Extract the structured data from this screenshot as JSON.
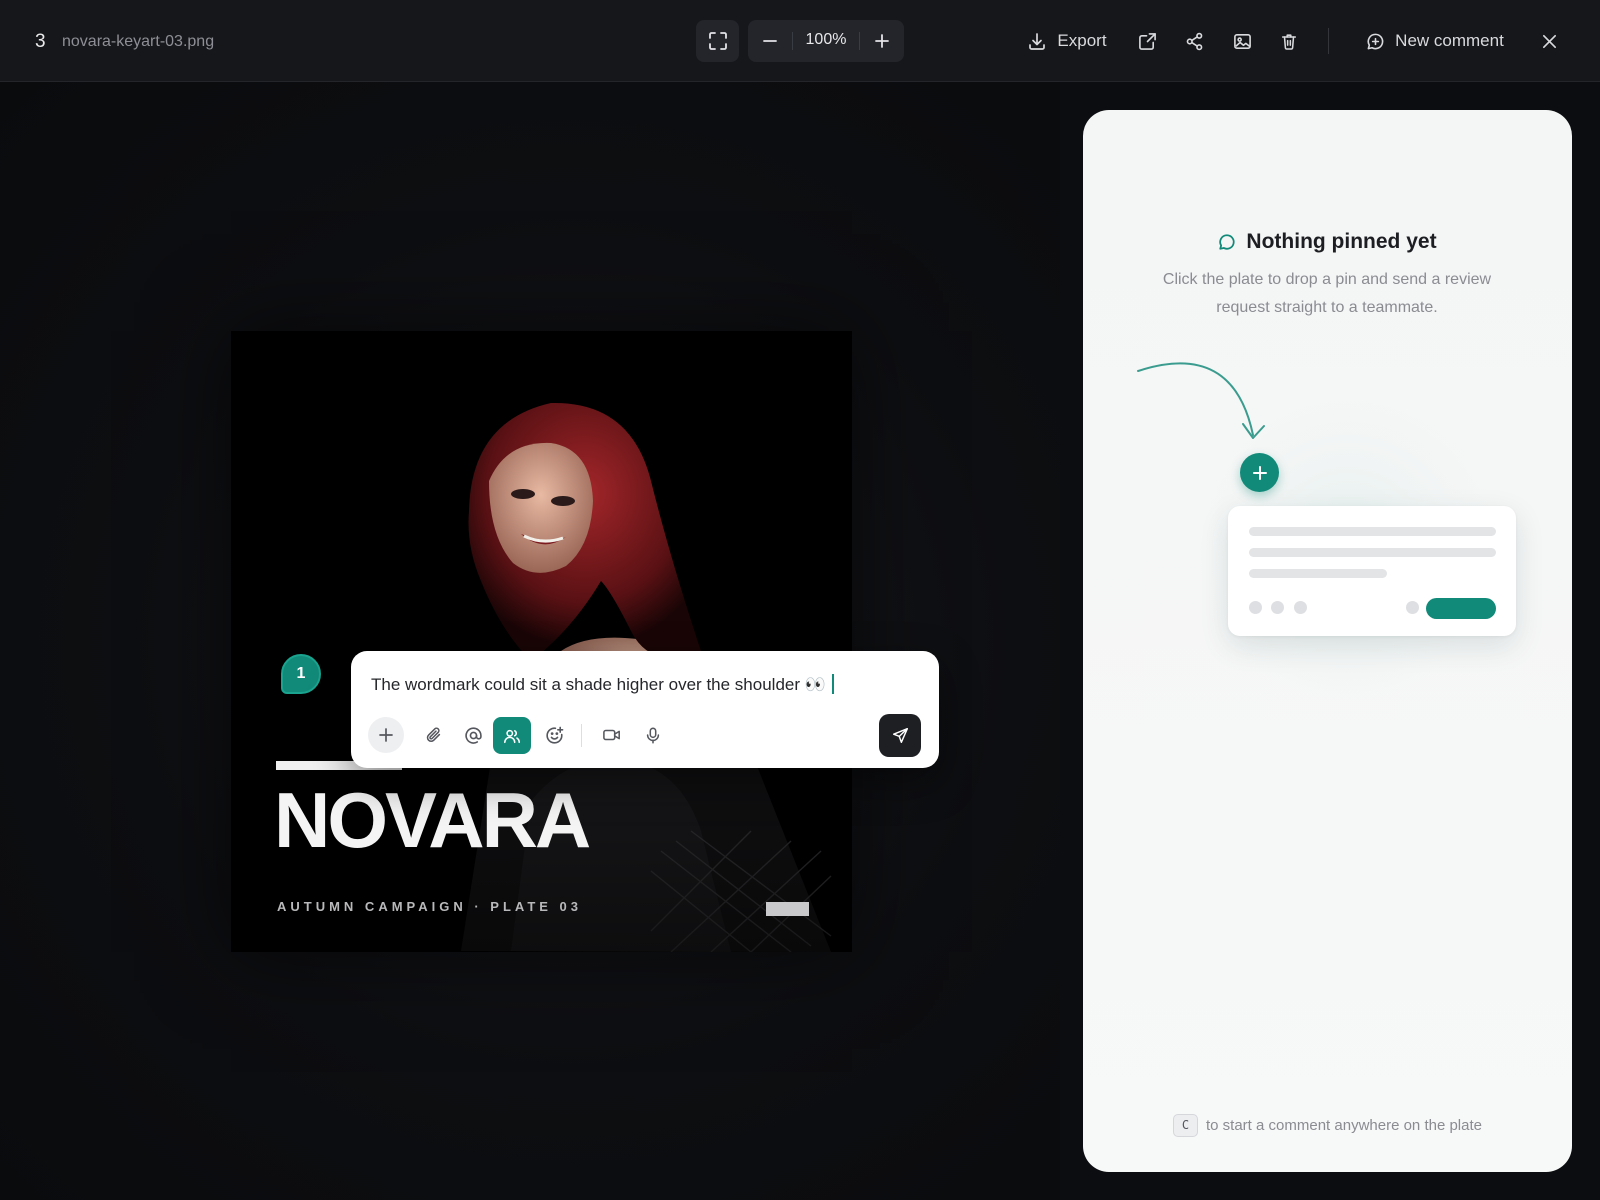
{
  "toolbar": {
    "file_count": "3",
    "file_name": "novara-keyart-03.png",
    "zoom_value": "100%",
    "export_label": "Export",
    "new_comment_label": "New comment"
  },
  "plate": {
    "wordmark": "NOVARA",
    "subtitle": "AUTUMN CAMPAIGN · PLATE 03"
  },
  "pin": {
    "number": "1"
  },
  "composer": {
    "text": "The wordmark could sit a shade higher over the shoulder 👀"
  },
  "panel": {
    "title": "Nothing pinned yet",
    "description": "Click the plate to drop a pin and send a review request straight to a teammate.",
    "hint_key": "C",
    "hint_text": "to start a comment anywhere on the plate"
  },
  "colors": {
    "accent": "#128a79",
    "topbar_bg": "#16171a",
    "canvas_bg": "#0c0d10",
    "panel_bg": "#f5f6f6"
  },
  "icons": [
    "fit-screen-icon",
    "minus-icon",
    "plus-icon",
    "download-icon",
    "open-external-icon",
    "share-icon",
    "image-icon",
    "trash-icon",
    "comment-add-icon",
    "close-icon",
    "attachment-icon",
    "mention-icon",
    "people-icon",
    "emoji-icon",
    "video-icon",
    "mic-icon",
    "send-icon",
    "comment-icon"
  ]
}
